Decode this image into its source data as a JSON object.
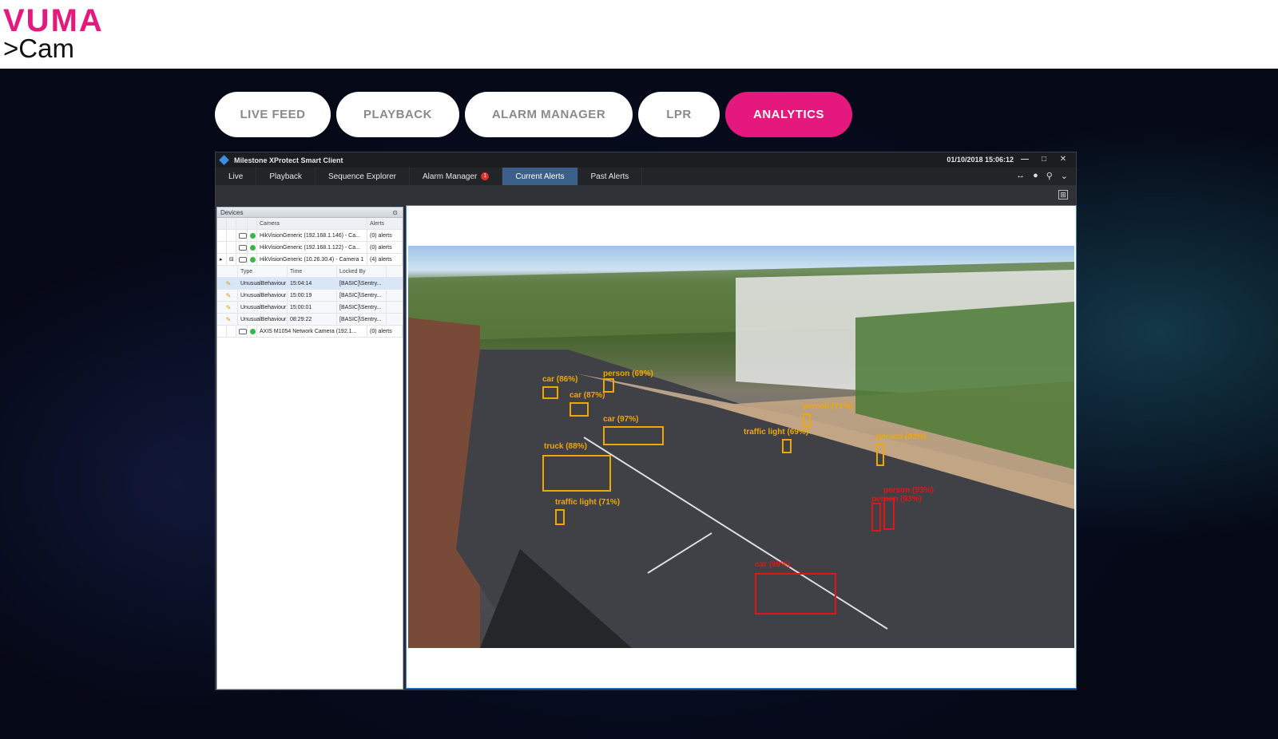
{
  "brand": {
    "name": "VUMA",
    "sub": ">Cam"
  },
  "tabs": [
    {
      "label": "LIVE FEED",
      "active": false
    },
    {
      "label": "PLAYBACK",
      "active": false
    },
    {
      "label": "ALARM MANAGER",
      "active": false
    },
    {
      "label": "LPR",
      "active": false
    },
    {
      "label": "ANALYTICS",
      "active": true
    }
  ],
  "app": {
    "title": "Milestone XProtect Smart Client",
    "datetime": "01/10/2018 15:06:12",
    "menu": [
      {
        "label": "Live",
        "active": false
      },
      {
        "label": "Playback",
        "active": false
      },
      {
        "label": "Sequence Explorer",
        "active": false
      },
      {
        "label": "Alarm Manager",
        "active": false,
        "badge": "1"
      },
      {
        "label": "Current Alerts",
        "active": true
      },
      {
        "label": "Past Alerts",
        "active": false
      }
    ],
    "devices": {
      "title": "Devices",
      "headers": [
        "Camera",
        "Alerts"
      ],
      "cameras": [
        {
          "name": "HikVisionGeneric (192.168.1.146) - Ca...",
          "alerts": "(0) alerts"
        },
        {
          "name": "HikVisionGeneric (192.168.1.122) - Ca...",
          "alerts": "(0) alerts"
        },
        {
          "name": "HikVisionGeneric (10.26.30.4) - Camera 1",
          "alerts": "(4) alerts"
        }
      ],
      "subheaders": [
        "Type",
        "Time",
        "Locked By"
      ],
      "alerts": [
        {
          "type": "UnusualBehaviour",
          "time": "15:04:14",
          "locked": "[BASIC]\\Sentry..."
        },
        {
          "type": "UnusualBehaviour",
          "time": "15:00:19",
          "locked": "[BASIC]\\Sentry..."
        },
        {
          "type": "UnusualBehaviour",
          "time": "15:00:01",
          "locked": "[BASIC]\\Sentry..."
        },
        {
          "type": "UnusualBehaviour",
          "time": "08:29:22",
          "locked": "[BASIC]\\Sentry..."
        }
      ],
      "last_camera": {
        "name": "AXIS M1054 Network Camera (192.1...",
        "alerts": "(0) alerts"
      }
    },
    "detections": [
      {
        "label": "person (69%)",
        "color": "orange"
      },
      {
        "label": "car (86%)",
        "color": "orange"
      },
      {
        "label": "car (87%)",
        "color": "orange"
      },
      {
        "label": "car (97%)",
        "color": "orange"
      },
      {
        "label": "truck (88%)",
        "color": "orange"
      },
      {
        "label": "traffic light (71%)",
        "color": "orange"
      },
      {
        "label": "traffic light (69%)",
        "color": "orange"
      },
      {
        "label": "person (71%)",
        "color": "orange"
      },
      {
        "label": "person (92%)",
        "color": "orange"
      },
      {
        "label": "person (93%)",
        "color": "red"
      },
      {
        "label": "person (93%)",
        "color": "red"
      },
      {
        "label": "car (99%)",
        "color": "red"
      }
    ]
  },
  "colors": {
    "brand": "#e5197d",
    "detect_orange": "#f0a800",
    "detect_red": "#e01616"
  }
}
